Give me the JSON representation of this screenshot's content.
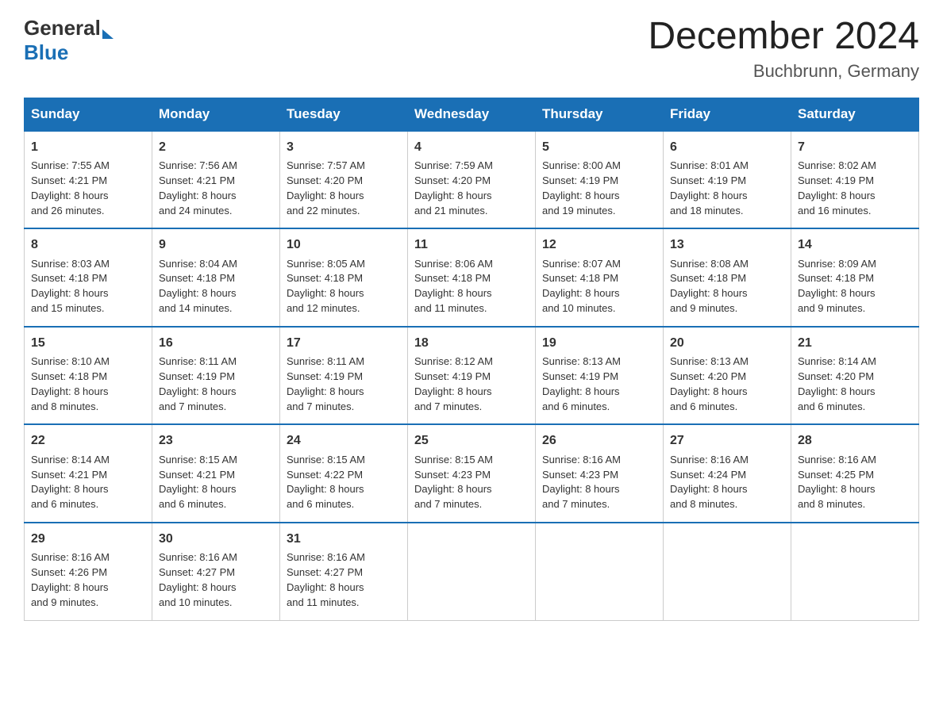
{
  "logo": {
    "general": "General",
    "blue": "Blue"
  },
  "title": "December 2024",
  "subtitle": "Buchbrunn, Germany",
  "days_of_week": [
    "Sunday",
    "Monday",
    "Tuesday",
    "Wednesday",
    "Thursday",
    "Friday",
    "Saturday"
  ],
  "weeks": [
    [
      {
        "day": "1",
        "sunrise": "7:55 AM",
        "sunset": "4:21 PM",
        "daylight": "8 hours and 26 minutes."
      },
      {
        "day": "2",
        "sunrise": "7:56 AM",
        "sunset": "4:21 PM",
        "daylight": "8 hours and 24 minutes."
      },
      {
        "day": "3",
        "sunrise": "7:57 AM",
        "sunset": "4:20 PM",
        "daylight": "8 hours and 22 minutes."
      },
      {
        "day": "4",
        "sunrise": "7:59 AM",
        "sunset": "4:20 PM",
        "daylight": "8 hours and 21 minutes."
      },
      {
        "day": "5",
        "sunrise": "8:00 AM",
        "sunset": "4:19 PM",
        "daylight": "8 hours and 19 minutes."
      },
      {
        "day": "6",
        "sunrise": "8:01 AM",
        "sunset": "4:19 PM",
        "daylight": "8 hours and 18 minutes."
      },
      {
        "day": "7",
        "sunrise": "8:02 AM",
        "sunset": "4:19 PM",
        "daylight": "8 hours and 16 minutes."
      }
    ],
    [
      {
        "day": "8",
        "sunrise": "8:03 AM",
        "sunset": "4:18 PM",
        "daylight": "8 hours and 15 minutes."
      },
      {
        "day": "9",
        "sunrise": "8:04 AM",
        "sunset": "4:18 PM",
        "daylight": "8 hours and 14 minutes."
      },
      {
        "day": "10",
        "sunrise": "8:05 AM",
        "sunset": "4:18 PM",
        "daylight": "8 hours and 12 minutes."
      },
      {
        "day": "11",
        "sunrise": "8:06 AM",
        "sunset": "4:18 PM",
        "daylight": "8 hours and 11 minutes."
      },
      {
        "day": "12",
        "sunrise": "8:07 AM",
        "sunset": "4:18 PM",
        "daylight": "8 hours and 10 minutes."
      },
      {
        "day": "13",
        "sunrise": "8:08 AM",
        "sunset": "4:18 PM",
        "daylight": "8 hours and 9 minutes."
      },
      {
        "day": "14",
        "sunrise": "8:09 AM",
        "sunset": "4:18 PM",
        "daylight": "8 hours and 9 minutes."
      }
    ],
    [
      {
        "day": "15",
        "sunrise": "8:10 AM",
        "sunset": "4:18 PM",
        "daylight": "8 hours and 8 minutes."
      },
      {
        "day": "16",
        "sunrise": "8:11 AM",
        "sunset": "4:19 PM",
        "daylight": "8 hours and 7 minutes."
      },
      {
        "day": "17",
        "sunrise": "8:11 AM",
        "sunset": "4:19 PM",
        "daylight": "8 hours and 7 minutes."
      },
      {
        "day": "18",
        "sunrise": "8:12 AM",
        "sunset": "4:19 PM",
        "daylight": "8 hours and 7 minutes."
      },
      {
        "day": "19",
        "sunrise": "8:13 AM",
        "sunset": "4:19 PM",
        "daylight": "8 hours and 6 minutes."
      },
      {
        "day": "20",
        "sunrise": "8:13 AM",
        "sunset": "4:20 PM",
        "daylight": "8 hours and 6 minutes."
      },
      {
        "day": "21",
        "sunrise": "8:14 AM",
        "sunset": "4:20 PM",
        "daylight": "8 hours and 6 minutes."
      }
    ],
    [
      {
        "day": "22",
        "sunrise": "8:14 AM",
        "sunset": "4:21 PM",
        "daylight": "8 hours and 6 minutes."
      },
      {
        "day": "23",
        "sunrise": "8:15 AM",
        "sunset": "4:21 PM",
        "daylight": "8 hours and 6 minutes."
      },
      {
        "day": "24",
        "sunrise": "8:15 AM",
        "sunset": "4:22 PM",
        "daylight": "8 hours and 6 minutes."
      },
      {
        "day": "25",
        "sunrise": "8:15 AM",
        "sunset": "4:23 PM",
        "daylight": "8 hours and 7 minutes."
      },
      {
        "day": "26",
        "sunrise": "8:16 AM",
        "sunset": "4:23 PM",
        "daylight": "8 hours and 7 minutes."
      },
      {
        "day": "27",
        "sunrise": "8:16 AM",
        "sunset": "4:24 PM",
        "daylight": "8 hours and 8 minutes."
      },
      {
        "day": "28",
        "sunrise": "8:16 AM",
        "sunset": "4:25 PM",
        "daylight": "8 hours and 8 minutes."
      }
    ],
    [
      {
        "day": "29",
        "sunrise": "8:16 AM",
        "sunset": "4:26 PM",
        "daylight": "8 hours and 9 minutes."
      },
      {
        "day": "30",
        "sunrise": "8:16 AM",
        "sunset": "4:27 PM",
        "daylight": "8 hours and 10 minutes."
      },
      {
        "day": "31",
        "sunrise": "8:16 AM",
        "sunset": "4:27 PM",
        "daylight": "8 hours and 11 minutes."
      },
      null,
      null,
      null,
      null
    ]
  ],
  "labels": {
    "sunrise": "Sunrise:",
    "sunset": "Sunset:",
    "daylight": "Daylight:"
  }
}
